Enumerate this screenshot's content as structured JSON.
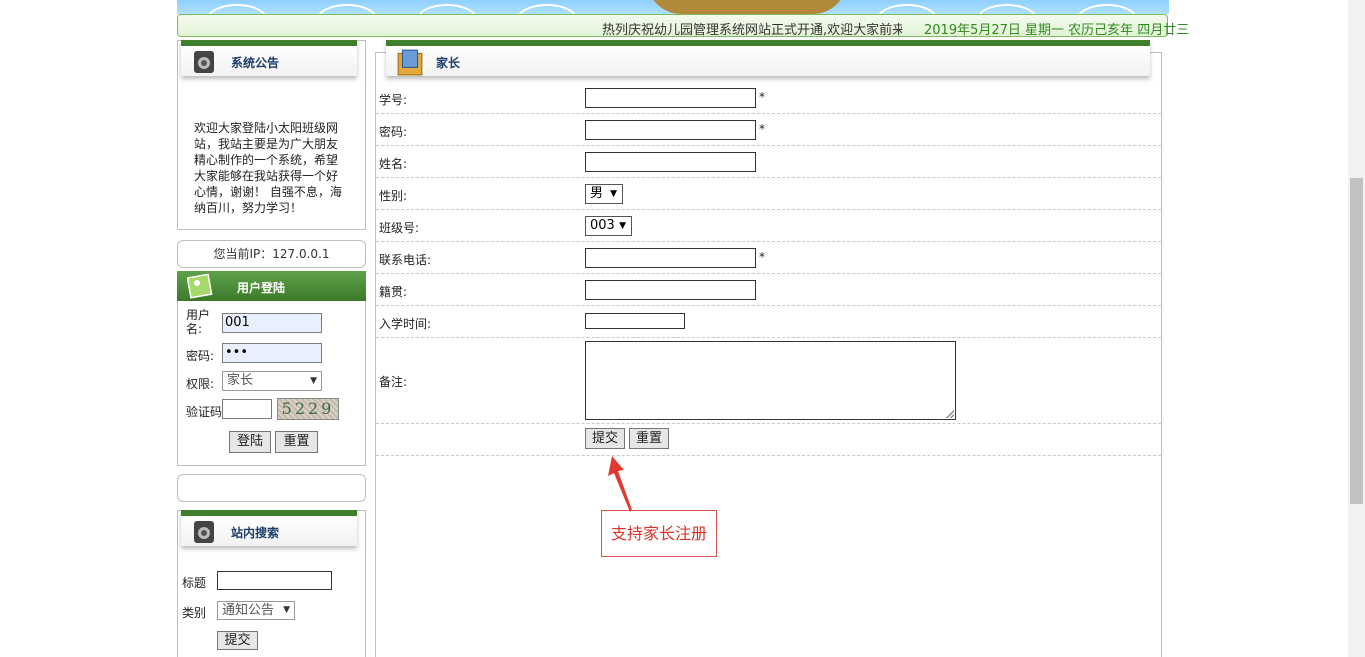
{
  "marquee": {
    "text": "热列庆祝幼儿园管理系统网站正式开通,欢迎大家前来光临",
    "date": "2019年5月27日 星期一 农历己亥年 四月廿三"
  },
  "notice": {
    "title": "系统公告",
    "body": "欢迎大家登陆小太阳班级网站，我站主要是为广大朋友精心制作的一个系统，希望大家能够在我站获得一个好心情，谢谢！ 自强不息，海纳百川，努力学习！"
  },
  "ip": {
    "text": "您当前IP：127.0.0.1"
  },
  "login": {
    "title": "用户登陆",
    "username_label": "用户名:",
    "username_value": "001",
    "password_label": "密码:",
    "password_value": "•••",
    "role_label": "权限:",
    "role_value": "家长",
    "captcha_label": "验证码",
    "captcha_text": "5229",
    "login_button": "登陆",
    "reset_button": "重置"
  },
  "search": {
    "title": "站内搜索",
    "title_label": "标题",
    "category_label": "类别",
    "category_value": "通知公告",
    "submit_button": "提交"
  },
  "form": {
    "title": "家长",
    "fields": [
      {
        "label": "学号:",
        "required": "*"
      },
      {
        "label": "密码:",
        "required": "*"
      },
      {
        "label": "姓名:"
      },
      {
        "label": "性别:",
        "value": "男"
      },
      {
        "label": "班级号:",
        "value": "003"
      },
      {
        "label": "联系电话:",
        "required": "*"
      },
      {
        "label": "籍贯:"
      },
      {
        "label": "入学时间:"
      },
      {
        "label": "备注:"
      }
    ],
    "submit_button": "提交",
    "reset_button": "重置"
  },
  "annotation": {
    "text": "支持家长注册",
    "color": "#d9342b"
  },
  "colors": {
    "brand_green": "#3f7f2c",
    "date_green": "#2f8a1d"
  }
}
